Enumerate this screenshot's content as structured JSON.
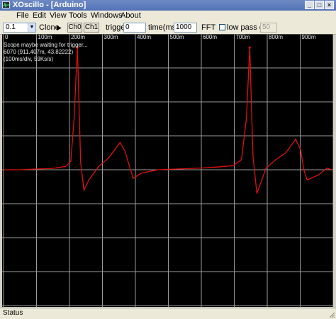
{
  "window": {
    "title": "XOscillo - [Arduino]"
  },
  "menu": {
    "items": [
      "File",
      "Edit",
      "View",
      "Tools",
      "Windows",
      "About"
    ]
  },
  "toolbar": {
    "scale_value": "0.1",
    "clone_label": "Clone",
    "ch0_label": "Ch0",
    "ch1_label": "Ch1",
    "trigger_label": "trigger",
    "trigger_value": "0",
    "time_label": "time(ms)",
    "time_value": "1000",
    "fft_label": "FFT",
    "lowpass_label": "low pass cof",
    "lowpass_value": "50"
  },
  "scope": {
    "overlay_lines": [
      "Scope maybe waiting for trigger...",
      "6070 (911.407m, 43.82222)",
      "(100ms/div, 59Ks/s)"
    ],
    "trace_color": "#e01010",
    "grid_color": "#9a9a9a"
  },
  "chart_data": {
    "type": "line",
    "title": "",
    "xlabel": "",
    "ylabel": "",
    "x_ticks": [
      "0",
      "100m",
      "200m",
      "300m",
      "400m",
      "500m",
      "600m",
      "700m",
      "800m",
      "900m"
    ],
    "xlim": [
      0,
      1
    ],
    "ylim": [
      -4,
      4
    ],
    "series": [
      {
        "x": [
          0,
          0.05,
          0.1,
          0.15,
          0.19,
          0.205,
          0.215,
          0.225,
          0.235,
          0.245,
          0.26,
          0.29,
          0.32,
          0.355,
          0.37,
          0.385,
          0.395,
          0.42,
          0.47,
          0.55,
          0.6,
          0.65,
          0.7,
          0.725,
          0.74,
          0.75,
          0.76,
          0.772,
          0.785,
          0.8,
          0.83,
          0.86,
          0.89,
          0.905,
          0.915,
          0.925,
          0.96,
          0.985,
          1.0
        ],
        "y": [
          0,
          0,
          0.02,
          0.04,
          0.1,
          0.25,
          1.5,
          3.6,
          0.2,
          -0.6,
          -0.3,
          0.1,
          0.35,
          0.8,
          0.55,
          0.05,
          -0.25,
          -0.1,
          0.0,
          0.03,
          0.05,
          0.08,
          0.12,
          0.3,
          1.5,
          3.6,
          0.4,
          -0.7,
          -0.35,
          0.05,
          0.3,
          0.5,
          0.9,
          0.6,
          0.0,
          -0.3,
          -0.15,
          0.05,
          0.0
        ]
      }
    ]
  },
  "statusbar": {
    "text": "Status"
  }
}
